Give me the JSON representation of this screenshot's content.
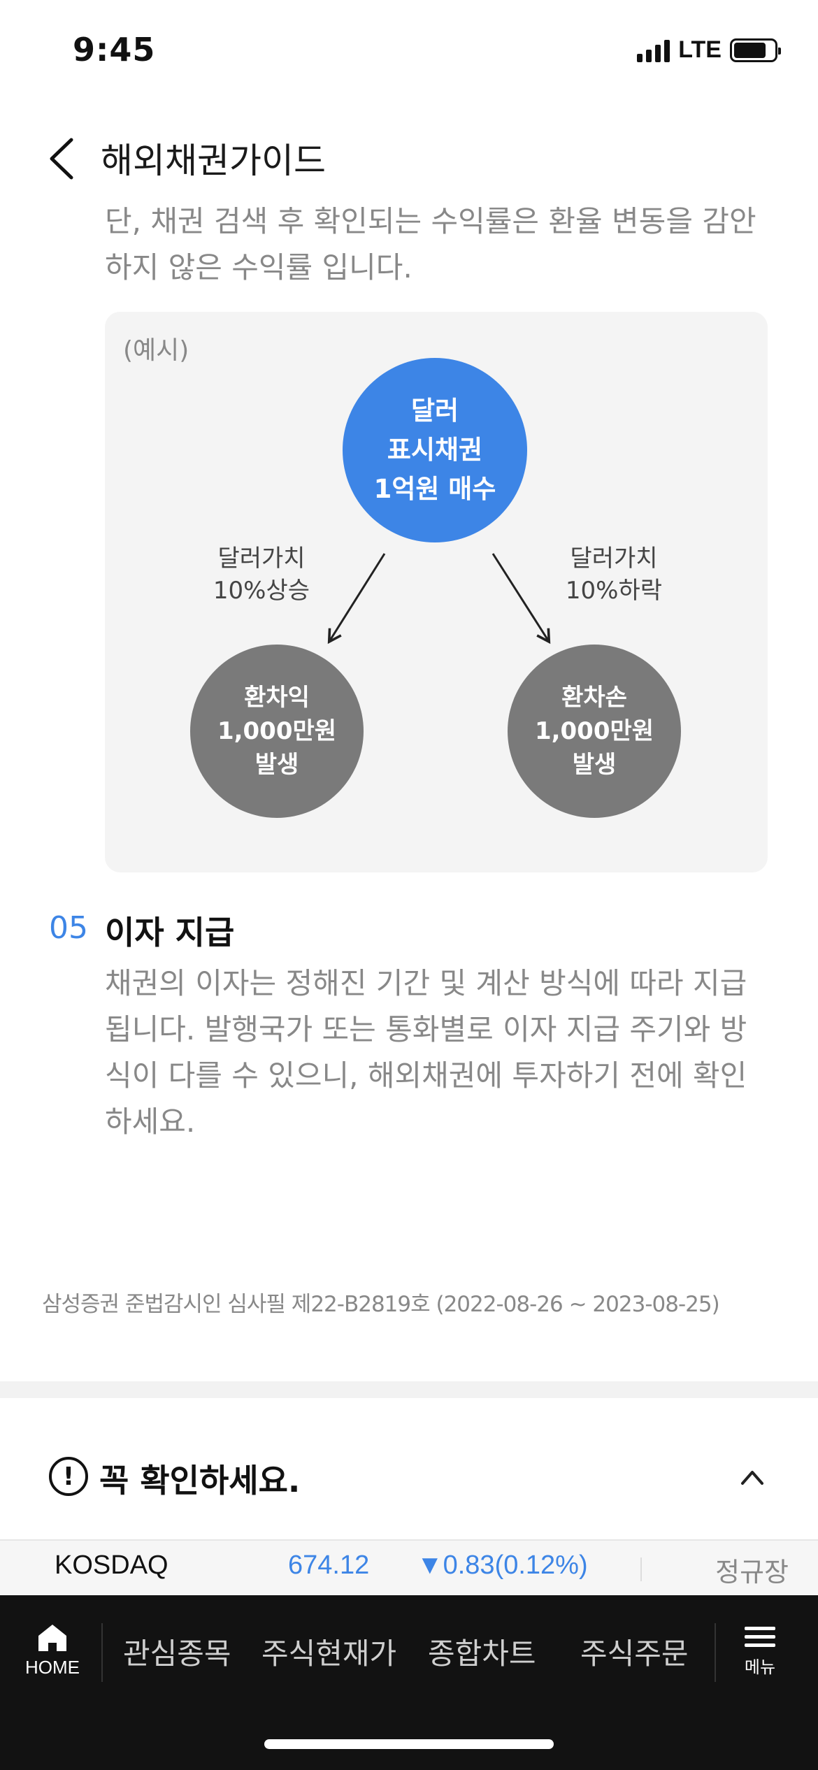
{
  "status_bar": {
    "time": "9:45",
    "network": "LTE"
  },
  "header": {
    "title": "해외채권가이드"
  },
  "intro": {
    "text": "단, 채권 검색 후 확인되는 수익률은 환율 변동을 감안하지 않은 수익률 입니다."
  },
  "example": {
    "label": "(예시)",
    "center": "달러\n표시채권\n1억원 매수",
    "left_branch_label": "달러가치\n10%상승",
    "right_branch_label": "달러가치\n10%하락",
    "left_result": "환차익\n1,000만원\n발생",
    "right_result": "환차손\n1,000만원\n발생"
  },
  "section": {
    "number": "05",
    "title": "이자 지급",
    "body": "채권의 이자는 정해진 기간 및 계산 방식에 따라 지급됩니다. 발행국가 또는 통화별로 이자 지급 주기와 방식이 다를 수 있으니, 해외채권에 투자하기 전에 확인하세요."
  },
  "compliance_notice": "삼성증권 준법감시인 심사필 제22-B2819호 (2022-08-26 ~ 2023-08-25)",
  "confirm": {
    "title": "꼭 확인하세요."
  },
  "ticker": {
    "name": "KOSDAQ",
    "price": "674.12",
    "change": "▼0.83(0.12%)",
    "session": "정규장",
    "color": "#3d85e6"
  },
  "bottom_nav": {
    "home_label": "HOME",
    "items": [
      "관심종목",
      "주식현재가",
      "종합차트",
      "주식주문"
    ],
    "menu_label": "메뉴"
  }
}
